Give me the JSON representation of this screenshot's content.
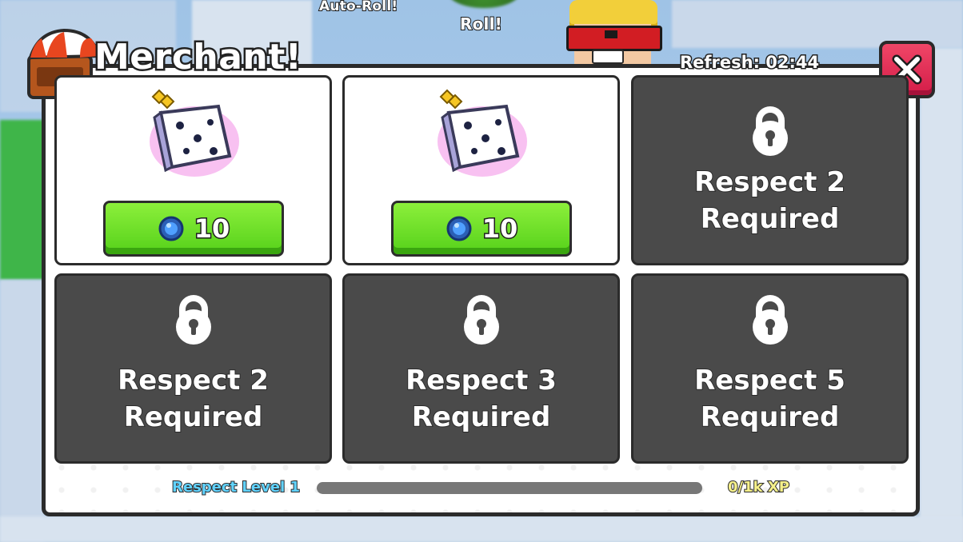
{
  "hud": {
    "auto_roll_label": "Auto-Roll!",
    "roll_label": "Roll!"
  },
  "merchant": {
    "title": "Merchant!",
    "refresh_text": "Refresh: 02:44",
    "close_icon": "x-icon",
    "items": [
      {
        "state": "unlocked",
        "item_icon": "dice-icon",
        "currency_icon": "gem-coin-icon",
        "price": "10"
      },
      {
        "state": "unlocked",
        "item_icon": "dice-icon",
        "currency_icon": "gem-coin-icon",
        "price": "10"
      },
      {
        "state": "locked",
        "lock_icon": "padlock-icon",
        "line1": "Respect 2",
        "line2": "Required"
      },
      {
        "state": "locked",
        "lock_icon": "padlock-icon",
        "line1": "Respect 2",
        "line2": "Required"
      },
      {
        "state": "locked",
        "lock_icon": "padlock-icon",
        "line1": "Respect 3",
        "line2": "Required"
      },
      {
        "state": "locked",
        "lock_icon": "padlock-icon",
        "line1": "Respect 5",
        "line2": "Required"
      }
    ],
    "footer": {
      "level_text": "Respect Level 1",
      "xp_text": "0/1k XP",
      "xp_progress": 0
    }
  },
  "colors": {
    "panel_border": "#2b2b2b",
    "locked_card": "#4a4a4a",
    "buy_button": "#55d11a",
    "close_button": "#d31c48",
    "level_text": "#61d3ff",
    "xp_text": "#f5f08a"
  }
}
